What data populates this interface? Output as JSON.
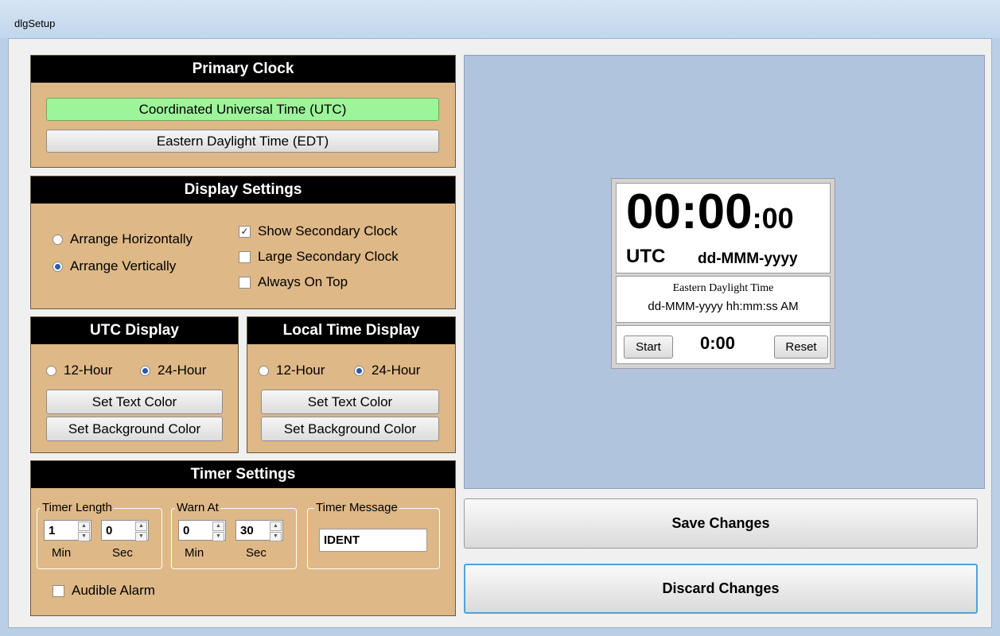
{
  "window": {
    "title": "dlgSetup"
  },
  "primary_clock": {
    "header": "Primary Clock",
    "options": [
      {
        "label": "Coordinated Universal Time (UTC)",
        "selected": true
      },
      {
        "label": "Eastern Daylight Time (EDT)",
        "selected": false
      }
    ]
  },
  "display_settings": {
    "header": "Display Settings",
    "arrange_horizontally": "Arrange Horizontally",
    "arrange_vertically": "Arrange Vertically",
    "show_secondary_clock": "Show Secondary Clock",
    "large_secondary_clock": "Large Secondary Clock",
    "always_on_top": "Always On Top",
    "checkmark": "✓"
  },
  "utc_display": {
    "header": "UTC Display",
    "hour12": "12-Hour",
    "hour24": "24-Hour",
    "set_text_color": "Set Text Color",
    "set_background_color": "Set Background Color"
  },
  "local_display": {
    "header": "Local Time Display",
    "hour12": "12-Hour",
    "hour24": "24-Hour",
    "set_text_color": "Set Text Color",
    "set_background_color": "Set Background Color"
  },
  "timer_settings": {
    "header": "Timer Settings",
    "timer_length": {
      "label": "Timer Length",
      "min": "1",
      "sec": "0"
    },
    "warn_at": {
      "label": "Warn At",
      "min": "0",
      "sec": "30"
    },
    "min_label": "Min",
    "sec_label": "Sec",
    "timer_message": {
      "label": "Timer Message",
      "value": "IDENT"
    },
    "audible_alarm": "Audible Alarm"
  },
  "preview": {
    "time_main": "00:00",
    "time_seconds": ":00",
    "zone": "UTC",
    "date_format": "dd-MMM-yyyy",
    "secondary_zone": "Eastern Daylight Time",
    "secondary_format": "dd-MMM-yyyy hh:mm:ss AM",
    "start_label": "Start",
    "timer_value": "0:00",
    "reset_label": "Reset"
  },
  "actions": {
    "save": "Save Changes",
    "discard": "Discard Changes"
  },
  "colors": {
    "panel": "#deb887",
    "header": "#000000",
    "selected_option": "#9df59a",
    "preview_bg": "#b0c4de",
    "focus_border": "#4fa3d8"
  }
}
